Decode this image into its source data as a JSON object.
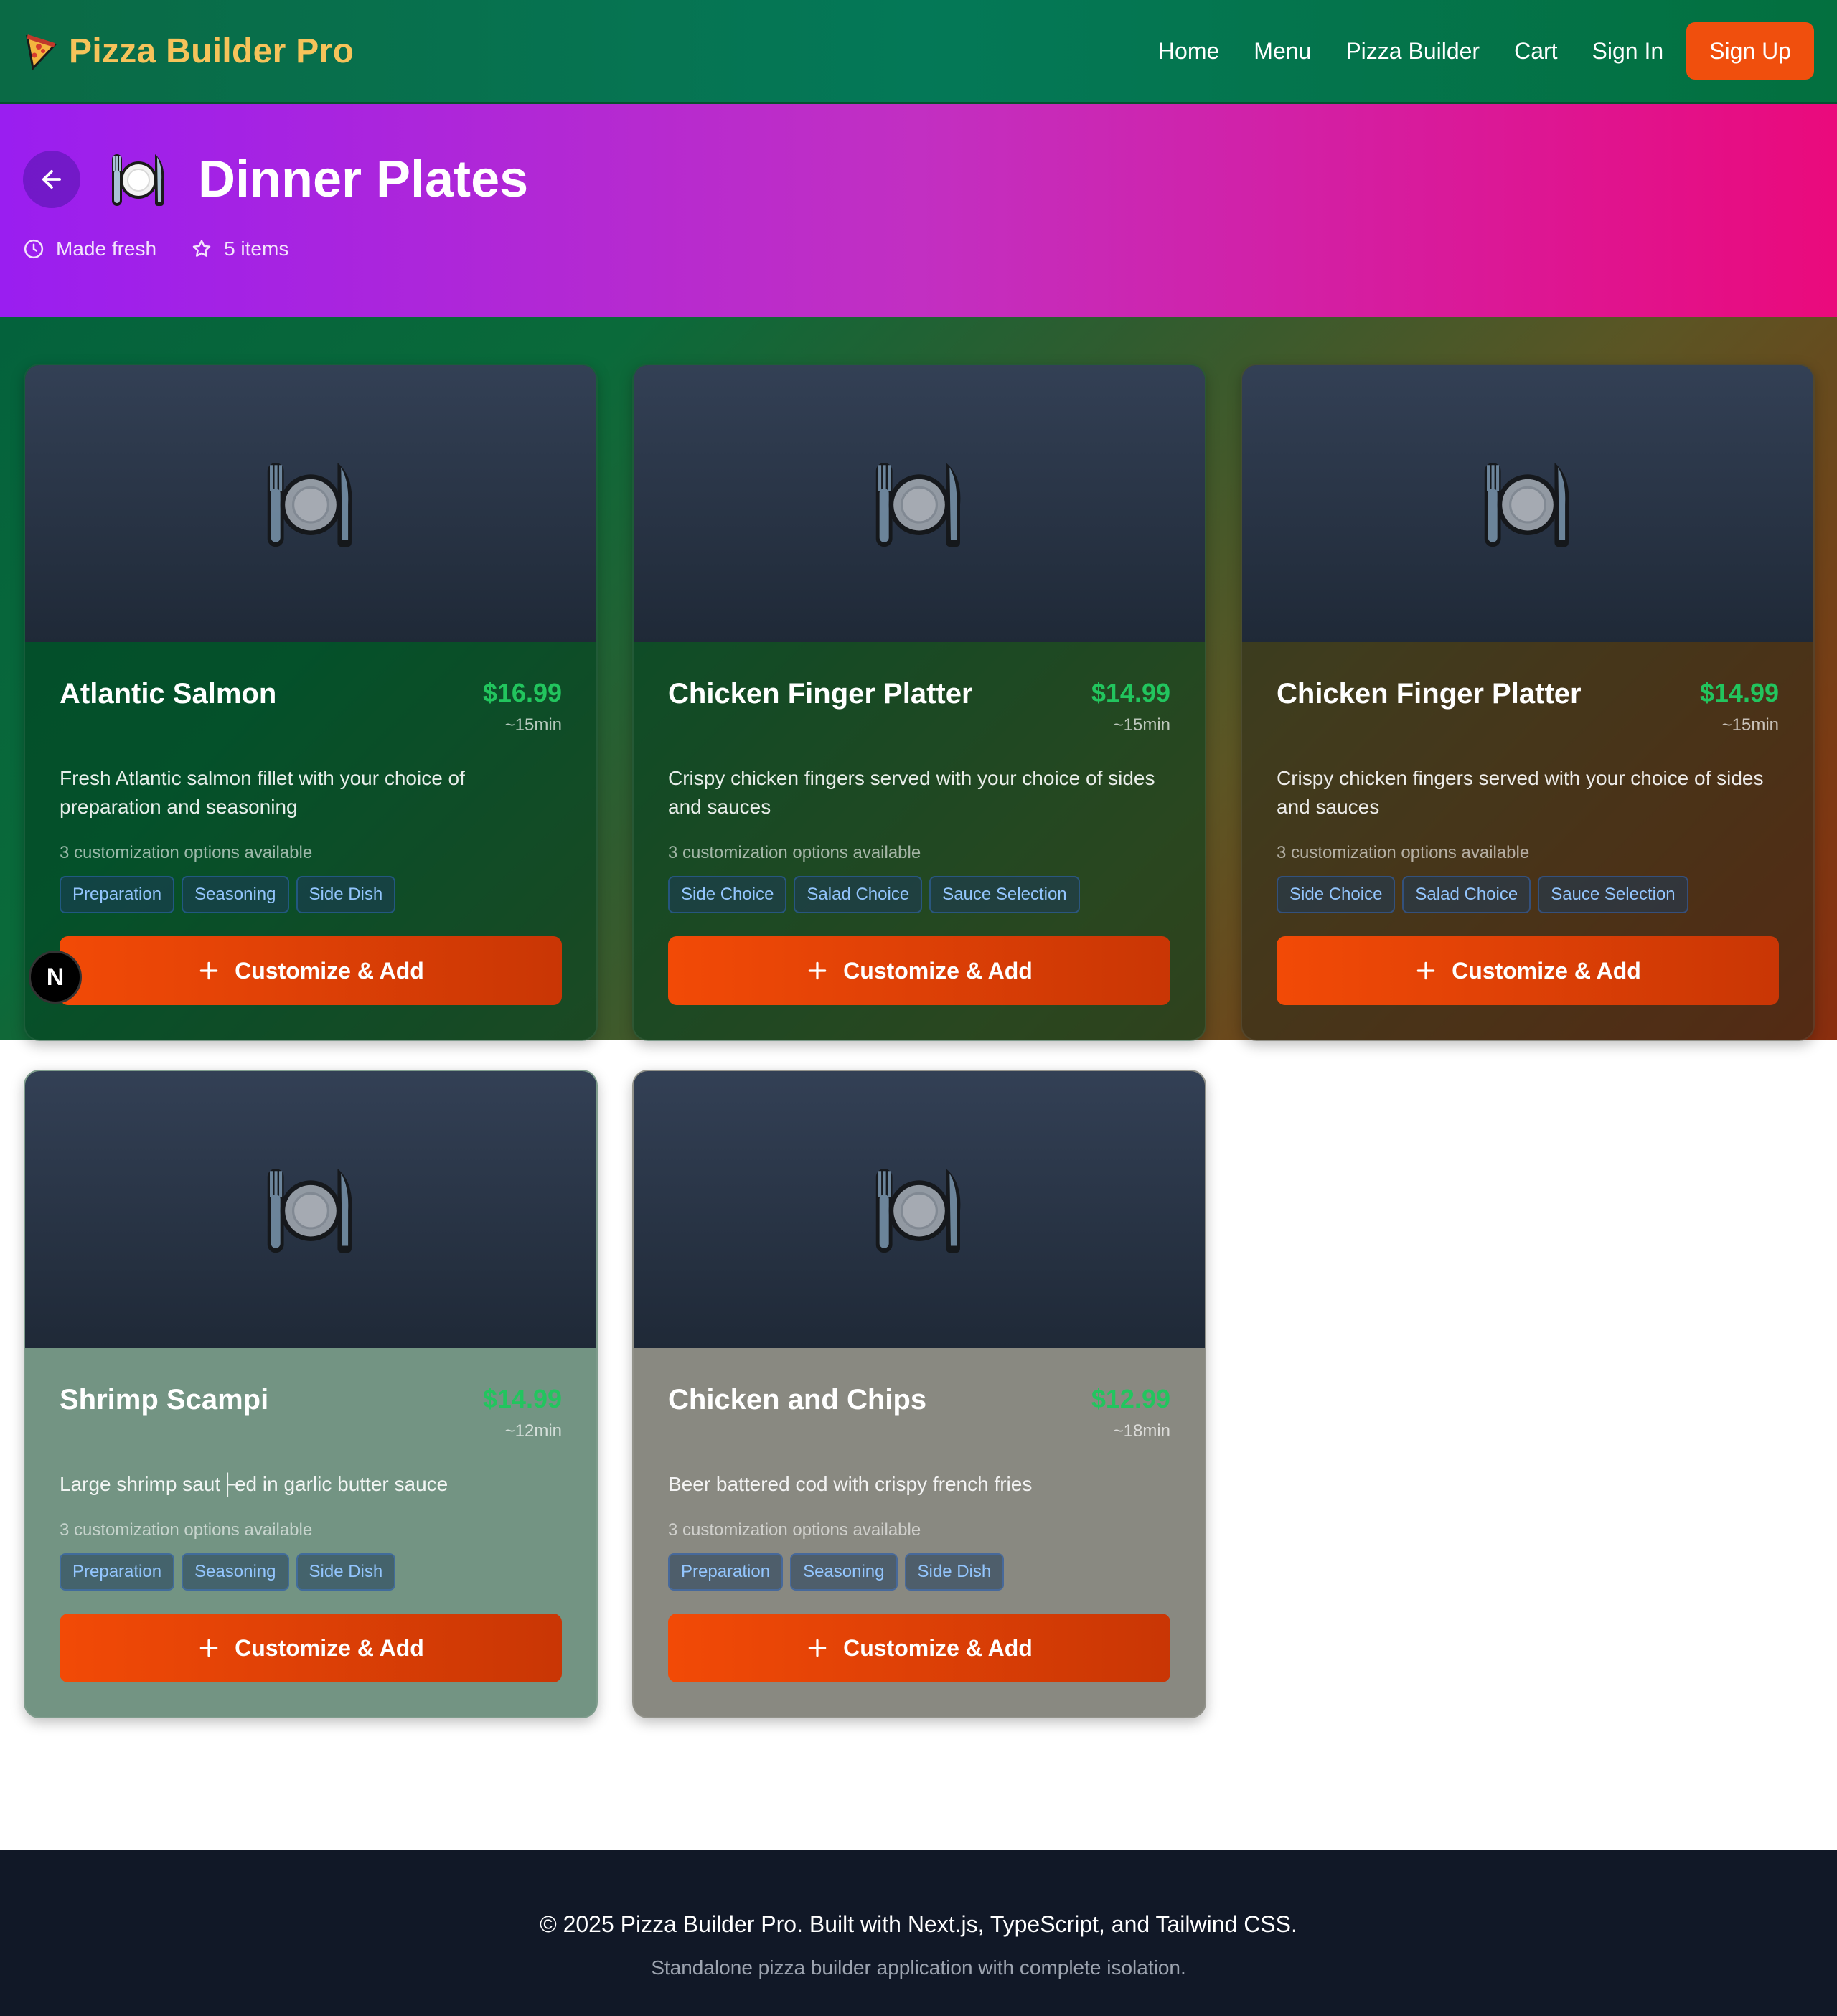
{
  "nav": {
    "brand": "Pizza Builder Pro",
    "links": [
      "Home",
      "Menu",
      "Pizza Builder",
      "Cart",
      "Sign In"
    ],
    "signup": "Sign Up"
  },
  "header": {
    "title": "Dinner Plates",
    "meta_fresh": "Made fresh",
    "meta_items": "5 items"
  },
  "cards": [
    {
      "title": "Atlantic Salmon",
      "price": "$16.99",
      "time": "~15min",
      "description": "Fresh Atlantic salmon fillet with your choice of preparation and seasoning",
      "options_count": "3 customization options available",
      "tags": [
        "Preparation",
        "Seasoning",
        "Side Dish"
      ],
      "button": "Customize & Add"
    },
    {
      "title": "Chicken Finger Platter",
      "price": "$14.99",
      "time": "~15min",
      "description": "Crispy chicken fingers served with your choice of sides and sauces",
      "options_count": "3 customization options available",
      "tags": [
        "Side Choice",
        "Salad Choice",
        "Sauce Selection"
      ],
      "button": "Customize & Add"
    },
    {
      "title": "Chicken Finger Platter",
      "price": "$14.99",
      "time": "~15min",
      "description": "Crispy chicken fingers served with your choice of sides and sauces",
      "options_count": "3 customization options available",
      "tags": [
        "Side Choice",
        "Salad Choice",
        "Sauce Selection"
      ],
      "button": "Customize & Add"
    },
    {
      "title": "Shrimp Scampi",
      "price": "$14.99",
      "time": "~12min",
      "description": "Large shrimp saut├ed in garlic butter sauce",
      "options_count": "3 customization options available",
      "tags": [
        "Preparation",
        "Seasoning",
        "Side Dish"
      ],
      "button": "Customize & Add"
    },
    {
      "title": "Chicken and Chips",
      "price": "$12.99",
      "time": "~18min",
      "description": "Beer battered cod with crispy french fries",
      "options_count": "3 customization options available",
      "tags": [
        "Preparation",
        "Seasoning",
        "Side Dish"
      ],
      "button": "Customize & Add"
    }
  ],
  "badge": "N",
  "footer": {
    "main": "© 2025 Pizza Builder Pro. Built with Next.js, TypeScript, and Tailwind CSS.",
    "sub": "Standalone pizza builder application with complete isolation."
  },
  "colors": {
    "price": "#22c55e",
    "cta": "#f04f0d",
    "brand": "#f6c35a"
  },
  "icons": {
    "brand": "pizza-icon",
    "back": "arrow-left-icon",
    "clock": "clock-icon",
    "star": "star-icon",
    "plate": "fork-knife-plate-icon",
    "plus": "plus-icon"
  }
}
